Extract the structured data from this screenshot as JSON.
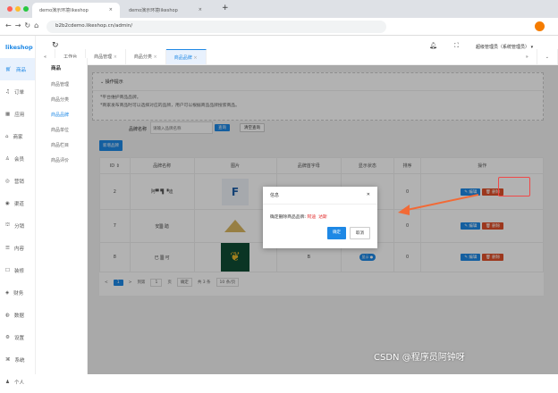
{
  "browser": {
    "tabs": [
      "demo演示环境likeshop",
      "demo演示环境likeshop"
    ],
    "new_tab": "+",
    "url": "b2b2cdemo.likeshop.cn/admin/"
  },
  "app": {
    "logo": "likeshop",
    "user": "超级管理员（系统管理员）"
  },
  "sidebar": [
    {
      "icon": "cart-icon",
      "label": "商品"
    },
    {
      "icon": "bell-icon",
      "label": "订单"
    },
    {
      "icon": "grid-icon",
      "label": "应用"
    },
    {
      "icon": "shop-icon",
      "label": "商家"
    },
    {
      "icon": "user-icon",
      "label": "会员"
    },
    {
      "icon": "marketing-icon",
      "label": "营销"
    },
    {
      "icon": "channel-icon",
      "label": "渠道"
    },
    {
      "icon": "distribution-icon",
      "label": "分销"
    },
    {
      "icon": "content-icon",
      "label": "内容"
    },
    {
      "icon": "decor-icon",
      "label": "装修"
    },
    {
      "icon": "finance-icon",
      "label": "财务"
    },
    {
      "icon": "data-icon",
      "label": "数据"
    },
    {
      "icon": "settings-icon",
      "label": "设置"
    },
    {
      "icon": "system-icon",
      "label": "系统"
    },
    {
      "icon": "person-icon",
      "label": "个人"
    }
  ],
  "subsidebar": {
    "title": "商品",
    "items": [
      "商品管理",
      "商品分类",
      "商品品牌",
      "商品单位",
      "商品栏目",
      "商品评价"
    ],
    "active": 2
  },
  "page_tabs": [
    {
      "label": "工作台"
    },
    {
      "label": "商品管理"
    },
    {
      "label": "商品分类"
    },
    {
      "label": "商品品牌"
    }
  ],
  "notice": {
    "title": "操作提示",
    "lines": [
      "*平台维护商品品牌。",
      "*商家发布商品时可以选择对应的品牌，用户可以根据商品品牌搜索商品。"
    ]
  },
  "search": {
    "label": "品牌名称",
    "placeholder": "请输入品牌名称",
    "query": "查询",
    "reset": "清空查询"
  },
  "add_button": "新增品牌",
  "table": {
    "headers": [
      "ID ⇕",
      "品牌名称",
      "图片",
      "品牌首字母",
      "显示状态",
      "排序",
      "操作"
    ],
    "rows": [
      {
        "id": "2",
        "name": "阿▀ ▜ ▝迪",
        "letter": "",
        "status": "",
        "sort": "0",
        "logo": "blue"
      },
      {
        "id": "7",
        "name": "安▒ 踏",
        "letter": "",
        "status": "",
        "sort": "0",
        "logo": "tan"
      },
      {
        "id": "8",
        "name": "已 ▒ 可",
        "letter": "B",
        "status": "显示",
        "sort": "0",
        "logo": "green"
      }
    ],
    "edit": "✎ 编辑",
    "delete": "🗑 删除"
  },
  "pagination": {
    "prev": "<",
    "page": "1",
    "next": ">",
    "goto": "到第",
    "input": "1",
    "unit": "页",
    "confirm": "确定",
    "total": "共 3 条",
    "per_page": "10 条/页"
  },
  "dialog": {
    "title": "信息",
    "message": "确定删除商品品牌:",
    "name1": "阿迪",
    "name2": "达斯",
    "ok": "确定",
    "cancel": "取消",
    "close": "✕"
  },
  "watermark": "CSDN @程序员阿钟呀",
  "colors": {
    "primary": "#1e88e5",
    "danger": "#e0502a",
    "annotation": "#f26a36"
  }
}
